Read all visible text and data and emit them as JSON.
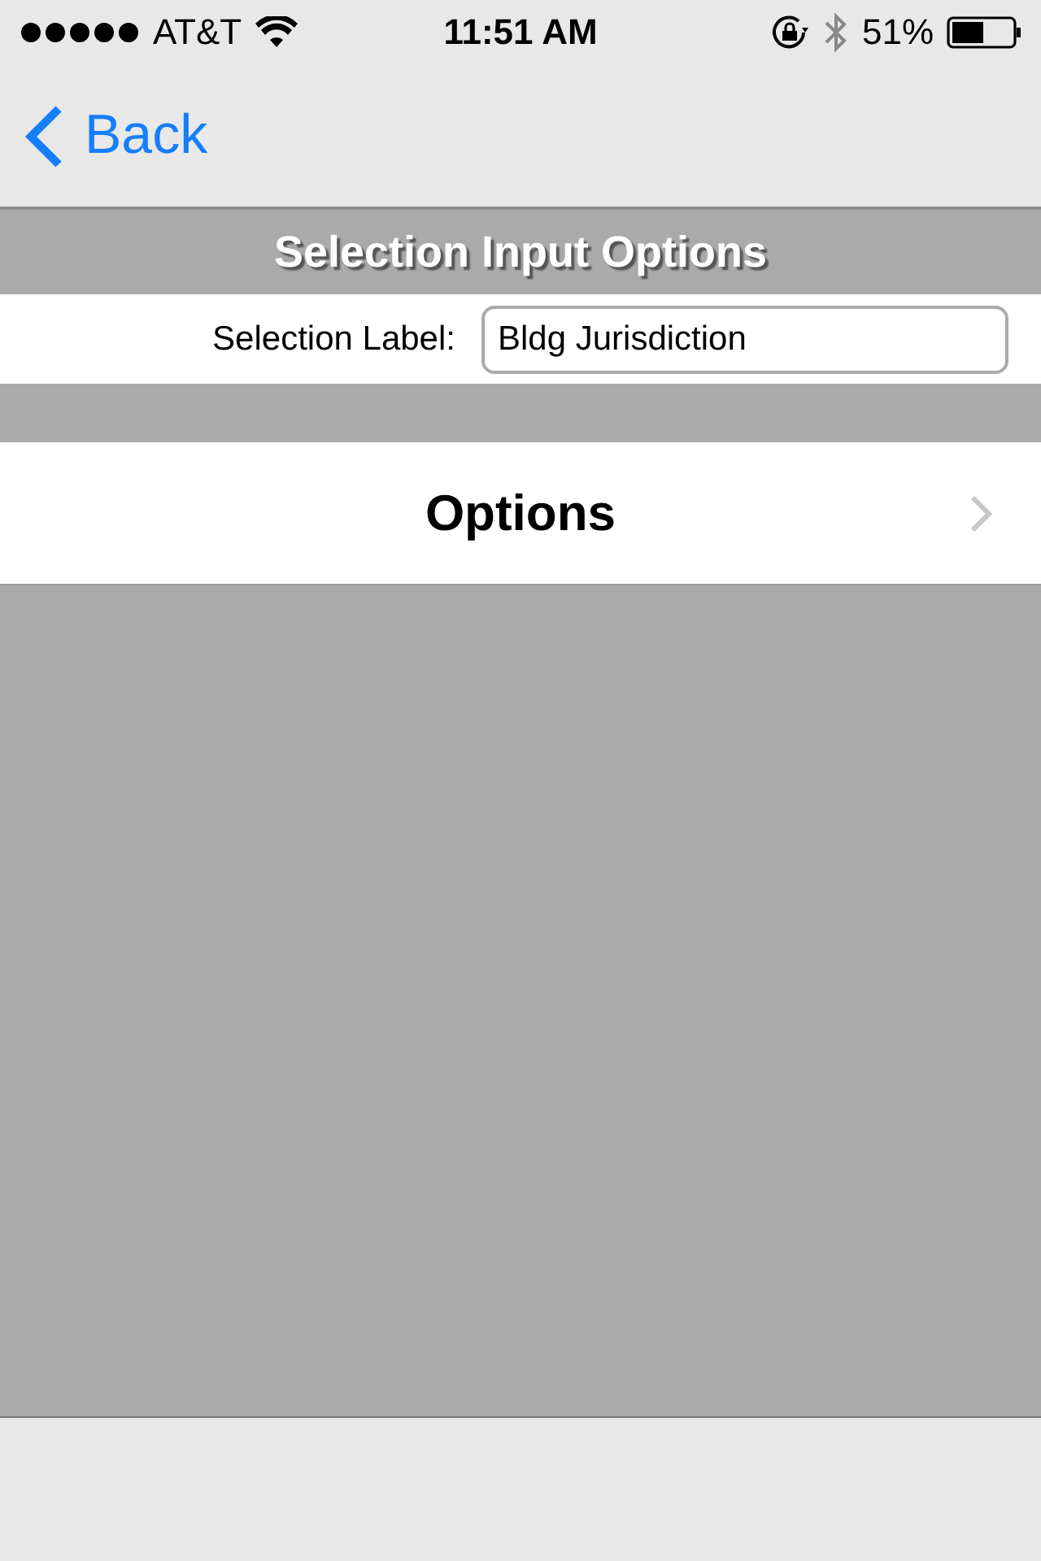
{
  "status_bar": {
    "carrier": "AT&T",
    "time": "11:51 AM",
    "battery": "51%"
  },
  "nav_bar": {
    "back": "Back"
  },
  "section": {
    "title": "Selection Input Options"
  },
  "field": {
    "label": "Selection Label:",
    "value": "Bldg Jurisdiction"
  },
  "rows": [
    {
      "label": "Options",
      "kind": "disclosure"
    }
  ]
}
